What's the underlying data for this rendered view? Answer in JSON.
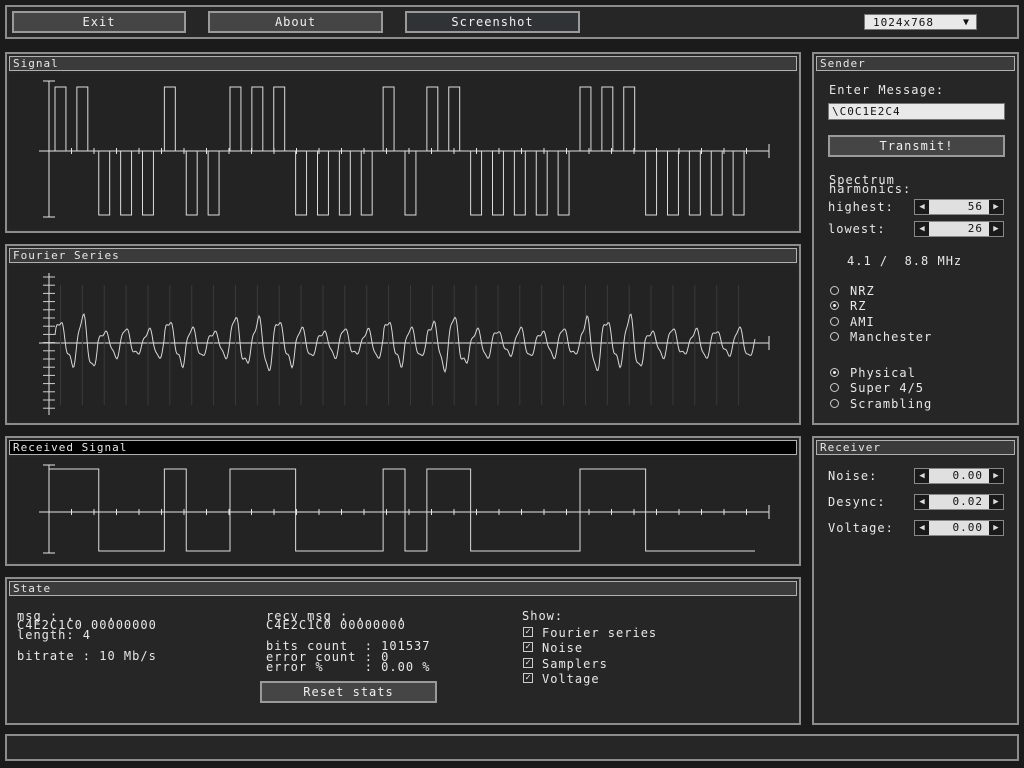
{
  "toolbar": {
    "exit_label": "Exit",
    "about_label": "About",
    "screenshot_label": "Screenshot",
    "resolution": "1024x768",
    "resolution_arrow": "▼"
  },
  "panels": {
    "signal_title": "Signal",
    "fourier_title": "Fourier Series",
    "received_title": "Received Signal",
    "state_title": "State",
    "sender_title": "Sender",
    "receiver_title": "Receiver"
  },
  "signal": {
    "encoding": "RZ",
    "bits": [
      1,
      1,
      0,
      0,
      0,
      1,
      0,
      0,
      1,
      1,
      1,
      0,
      0,
      0,
      0,
      1,
      0,
      1,
      1,
      0,
      0,
      0,
      0,
      0,
      1,
      1,
      1,
      0,
      0,
      0,
      0,
      0
    ]
  },
  "received": {
    "levels": [
      1,
      1,
      0,
      0,
      0,
      1,
      0,
      0,
      1,
      1,
      1,
      0,
      0,
      0,
      0,
      1,
      0,
      1,
      1,
      0,
      0,
      0,
      0,
      0,
      1,
      1,
      1,
      0,
      0,
      0,
      0,
      0
    ]
  },
  "sender": {
    "enter_message_label": "Enter Message:",
    "message_value": "\\C0C1E2C4",
    "transmit_label": "Transmit!",
    "spectrum_label_1": "Spectrum",
    "spectrum_label_2": "harmonics:",
    "highest_label": "highest:",
    "highest_value": "56",
    "lowest_label": "lowest:",
    "lowest_value": "26",
    "frequency_text": "4.1 /  8.8 MHz",
    "encodings": [
      {
        "label": "NRZ",
        "selected": false
      },
      {
        "label": "RZ",
        "selected": true
      },
      {
        "label": "AMI",
        "selected": false
      },
      {
        "label": "Manchester",
        "selected": false
      }
    ],
    "layers": [
      {
        "label": "Physical",
        "selected": true
      },
      {
        "label": "Super 4/5",
        "selected": false
      },
      {
        "label": "Scrambling",
        "selected": false
      }
    ]
  },
  "receiver": {
    "noise_label": "Noise:",
    "noise_value": "0.00",
    "desync_label": "Desync:",
    "desync_value": "0.02",
    "voltage_label": "Voltage:",
    "voltage_value": "0.00"
  },
  "state": {
    "msg_line": "msg : ,    ,",
    "msg_hex": "C4E2C1C0 00000000",
    "length_line": "length: 4",
    "bitrate_line": "bitrate : 10 Mb/s",
    "recv_msg_line": "recv msg : ,    ,",
    "recv_hex": "C4E2C1C0 00000000",
    "bits_count_line": "bits count  : 101537",
    "error_count_line": "error count : 0",
    "error_pct_line": "error %     : 0.00 %",
    "reset_label": "Reset stats",
    "show_label": "Show:",
    "show_options": [
      {
        "label": "Fourier series",
        "checked": true
      },
      {
        "label": "Noise",
        "checked": true
      },
      {
        "label": "Samplers",
        "checked": true
      },
      {
        "label": "Voltage",
        "checked": true
      }
    ]
  },
  "glyphs": {
    "left_arrow": "◀",
    "right_arrow": "▶",
    "check": "✓"
  }
}
